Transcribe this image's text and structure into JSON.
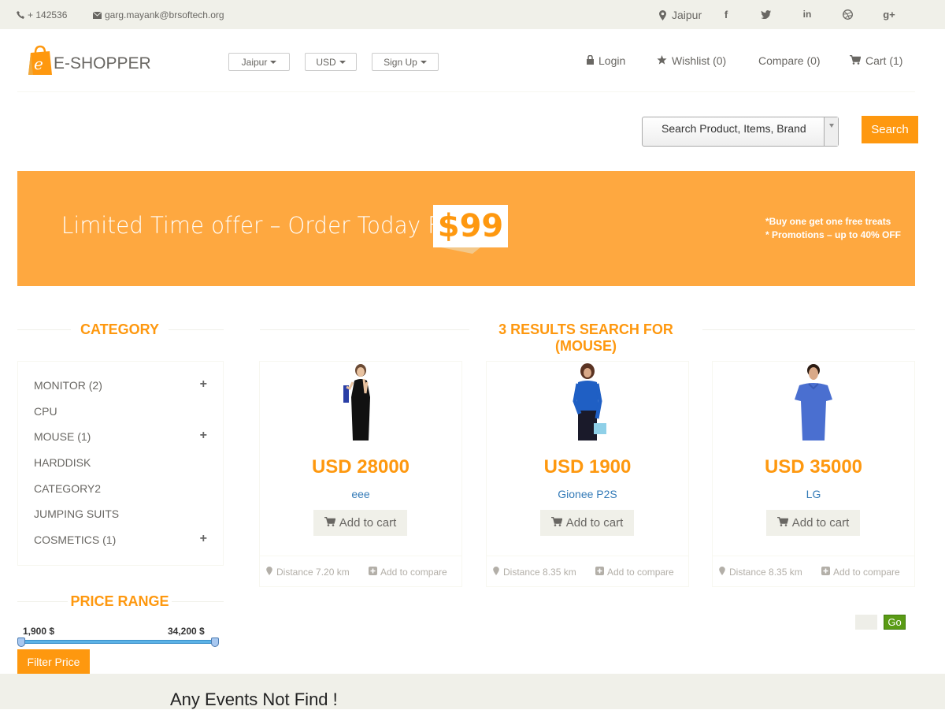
{
  "topbar": {
    "phone": "+ 142536",
    "email": "garg.mayank@brsoftech.org",
    "location": "Jaipur",
    "social_icons": [
      "facebook-icon",
      "twitter-icon",
      "linkedin-icon",
      "dribbble-icon",
      "google-plus-icon"
    ]
  },
  "header": {
    "logo_letter": "e",
    "logo_text": "E-SHOPPER",
    "dropdowns": [
      "Jaipur",
      "USD",
      "Sign Up"
    ],
    "nav": {
      "login": "Login",
      "wishlist": "Wishlist (0)",
      "compare": "Compare (0)",
      "cart": "Cart (1)"
    }
  },
  "search": {
    "select_label": "Search Product, Items, Brand",
    "button": "Search"
  },
  "banner": {
    "headline": "Limited Time offer – Order Today For",
    "price": "$99",
    "promo_line1": "*Buy one get one free treats",
    "promo_line2": "* Promotions – up to 40% OFF"
  },
  "sidebar": {
    "category_title": "CATEGORY",
    "categories": [
      {
        "label": "MONITOR (2)",
        "expandable": true
      },
      {
        "label": "CPU",
        "expandable": false
      },
      {
        "label": "MOUSE (1)",
        "expandable": true
      },
      {
        "label": "HARDDISK",
        "expandable": false
      },
      {
        "label": "CATEGORY2",
        "expandable": false
      },
      {
        "label": "JUMPING SUITS",
        "expandable": false
      },
      {
        "label": "COSMETICS (1)",
        "expandable": true
      }
    ],
    "price_range_title": "PRICE RANGE",
    "price_min": "1,900 $",
    "price_max": "34,200 $",
    "filter_button": "Filter Price"
  },
  "results": {
    "title": "3 RESULTS SEARCH FOR (MOUSE)",
    "products": [
      {
        "price": "USD 28000",
        "name": "eee",
        "cart": "Add to cart",
        "distance": "Distance 7.20 km",
        "compare": "Add to compare"
      },
      {
        "price": "USD 1900",
        "name": "Gionee P2S",
        "cart": "Add to cart",
        "distance": "Distance 8.35 km",
        "compare": "Add to compare"
      },
      {
        "price": "USD 35000",
        "name": "LG",
        "cart": "Add to cart",
        "distance": "Distance 8.35 km",
        "compare": "Add to compare"
      }
    ],
    "go_button": "Go"
  },
  "footer": {
    "events_text": "Any Events Not Find !"
  },
  "colors": {
    "accent": "#fe980f",
    "banner": "#fea840",
    "link": "#337ab7",
    "go": "#5a9b15"
  }
}
